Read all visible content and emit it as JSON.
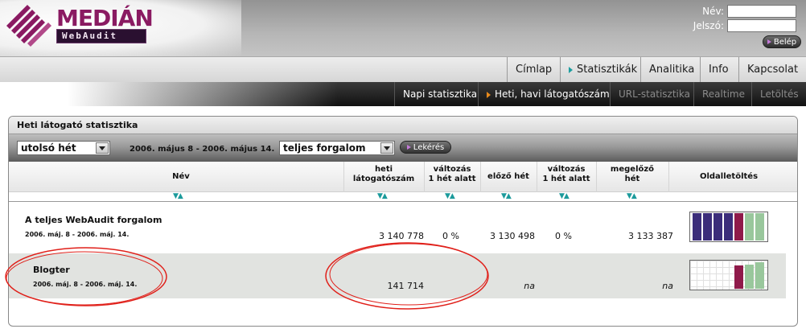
{
  "logo": {
    "wordmark": "MEDIÁN",
    "sub": "WebAudit"
  },
  "login": {
    "name_label": "Név:",
    "password_label": "Jelszó:",
    "button": "Belép"
  },
  "nav": {
    "items": [
      "Címlap",
      "Statisztikák",
      "Analitika",
      "Info",
      "Kapcsolat"
    ],
    "active": "Statisztikák"
  },
  "subnav": {
    "items": [
      "Napi statisztika",
      "Heti, havi látogatószám",
      "URL-statisztika",
      "Realtime",
      "Letöltés"
    ],
    "active": "Heti, havi látogatószám"
  },
  "panel": {
    "title": "Heti látogató statisztika",
    "period_select": "utolsó hét",
    "date_range": "2006. május 8 - 2006. május 14.",
    "traffic_select": "teljes forgalom",
    "query_button": "Lekérés"
  },
  "table": {
    "headers": {
      "name": "Név",
      "weekly_1": "heti",
      "weekly_2": "látogatószám",
      "change_1": "változás",
      "change_2": "1 hét alatt",
      "prev_week": "előző hét",
      "change2_1": "változás",
      "change2_2": "1 hét alatt",
      "before_1": "megelőző",
      "before_2": "hét",
      "download": "Oldalletöltés"
    },
    "sort_glyph": "▼▲",
    "rows": [
      {
        "name": "A teljes WebAudit forgalom",
        "date": "2006. máj. 8 - 2006. máj. 14.",
        "weekly": "3 140 778",
        "change": "0 %",
        "prev": "3 130 498",
        "change2": "0 %",
        "before": "3 133 387",
        "bars": [
          {
            "value": 1.0,
            "color": "#3b2d7a"
          },
          {
            "value": 1.0,
            "color": "#3b2d7a"
          },
          {
            "value": 1.0,
            "color": "#3b2d7a"
          },
          {
            "value": 1.0,
            "color": "#3b2d7a"
          },
          {
            "value": 1.0,
            "color": "#8f1a4a"
          },
          {
            "value": 1.0,
            "color": "#99c79c"
          },
          {
            "value": 1.0,
            "color": "#99c79c"
          }
        ]
      },
      {
        "name": "Blogter",
        "date": "2006. máj. 8 - 2006. máj. 14.",
        "weekly": "141 714",
        "change": "",
        "prev": "na",
        "change2": "",
        "before": "na",
        "bars": [
          {
            "value": 0,
            "color": "#3b2d7a"
          },
          {
            "value": 0,
            "color": "#3b2d7a"
          },
          {
            "value": 0,
            "color": "#3b2d7a"
          },
          {
            "value": 0,
            "color": "#3b2d7a"
          },
          {
            "value": 0.85,
            "color": "#8f1a4a"
          },
          {
            "value": 0.88,
            "color": "#99c79c"
          },
          {
            "value": 0.98,
            "color": "#99c79c"
          }
        ]
      }
    ]
  },
  "colors": {
    "accent_teal": "#1d9ea0",
    "annotation_red": "#e0201a"
  }
}
